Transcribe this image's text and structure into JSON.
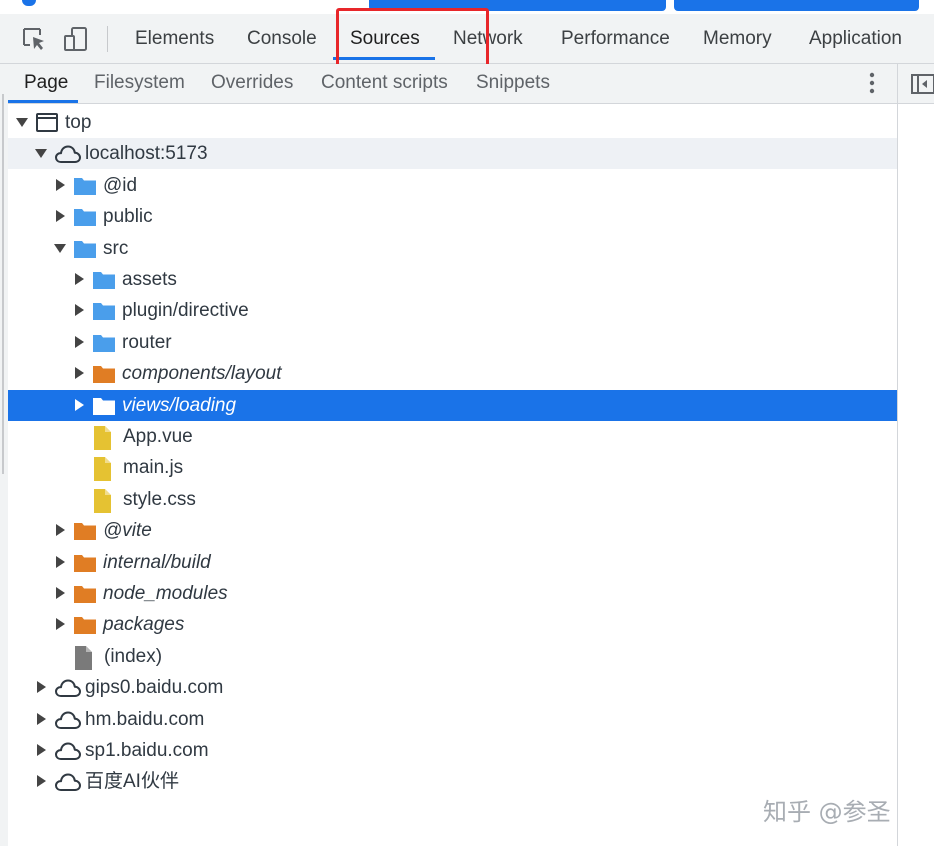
{
  "colors": {
    "accent": "#1a73e8",
    "highlight": "#e8262a",
    "folder_blue": "#4a9eeb",
    "folder_orange": "#e07d24",
    "file_yellow": "#e5c232",
    "file_gray": "#7a7a7a"
  },
  "main_tabs": [
    {
      "label": "Elements"
    },
    {
      "label": "Console"
    },
    {
      "label": "Sources",
      "active": true
    },
    {
      "label": "Network"
    },
    {
      "label": "Performance"
    },
    {
      "label": "Memory"
    },
    {
      "label": "Application"
    }
  ],
  "sub_tabs": [
    {
      "label": "Page",
      "active": true
    },
    {
      "label": "Filesystem"
    },
    {
      "label": "Overrides"
    },
    {
      "label": "Content scripts"
    },
    {
      "label": "Snippets"
    }
  ],
  "tree": [
    {
      "label": "top",
      "icon": "frame-icon",
      "expanded": true
    },
    {
      "label": "localhost:5173",
      "icon": "cloud-icon",
      "expanded": true
    },
    {
      "label": "@id",
      "icon": "folder-blue-icon",
      "expanded": false
    },
    {
      "label": "public",
      "icon": "folder-blue-icon",
      "expanded": false
    },
    {
      "label": "src",
      "icon": "folder-blue-icon",
      "expanded": true
    },
    {
      "label": "assets",
      "icon": "folder-blue-icon",
      "expanded": false
    },
    {
      "label": "plugin/directive",
      "icon": "folder-blue-icon",
      "expanded": false
    },
    {
      "label": "router",
      "icon": "folder-blue-icon",
      "expanded": false
    },
    {
      "label": "components/layout",
      "icon": "folder-orange-icon",
      "expanded": false
    },
    {
      "label": "views/loading",
      "icon": "folder-white-icon",
      "expanded": false,
      "selected": true
    },
    {
      "label": "App.vue",
      "icon": "file-yellow-icon"
    },
    {
      "label": "main.js",
      "icon": "file-yellow-icon"
    },
    {
      "label": "style.css",
      "icon": "file-yellow-icon"
    },
    {
      "label": "@vite",
      "icon": "folder-orange-icon",
      "expanded": false
    },
    {
      "label": "internal/build",
      "icon": "folder-orange-icon",
      "expanded": false
    },
    {
      "label": "node_modules",
      "icon": "folder-orange-icon",
      "expanded": false
    },
    {
      "label": "packages",
      "icon": "folder-orange-icon",
      "expanded": false
    },
    {
      "label": "(index)",
      "icon": "file-gray-icon"
    },
    {
      "label": "gips0.baidu.com",
      "icon": "cloud-icon",
      "expanded": false
    },
    {
      "label": "hm.baidu.com",
      "icon": "cloud-icon",
      "expanded": false
    },
    {
      "label": "sp1.baidu.com",
      "icon": "cloud-icon",
      "expanded": false
    },
    {
      "label": "百度AI伙伴",
      "icon": "cloud-icon",
      "expanded": false
    }
  ],
  "watermark": "知乎 @参圣"
}
